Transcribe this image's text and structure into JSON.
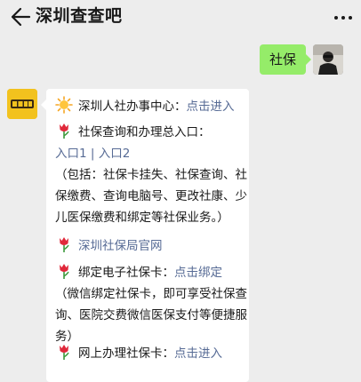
{
  "header": {
    "title": "深圳查查吧"
  },
  "chat": {
    "user_message": "社保",
    "bot": {
      "line1_label": "深圳人社办事中心：",
      "line1_link": "点击进入",
      "line2_label": "社保查询和办理总入口：",
      "entry1": "入口1",
      "separator": "|",
      "entry2": "入口2",
      "desc1": "（包括：社保卡挂失、社保查询、社保缴费、查询电脑号、更改社康、少儿医保缴费和绑定等社保业务。）",
      "line3_link": "深圳社保局官网",
      "line4_label": "绑定电子社保卡：",
      "line4_link": "点击绑定",
      "desc2": "（微信绑定社保卡，即可享受社保查询、医院交费微信医保支付等便捷服务）",
      "line5_label": "网上办理社保卡：",
      "line5_link": "点击进入"
    }
  },
  "icons": {
    "back": "arrow-left-icon",
    "more": "more-dots-icon",
    "sun": "sun-emoji-icon",
    "tulip": "tulip-emoji-icon"
  },
  "colors": {
    "background": "#ededed",
    "user_bubble": "#95ec69",
    "link": "#576b95",
    "bot_avatar": "#f2c21e"
  }
}
